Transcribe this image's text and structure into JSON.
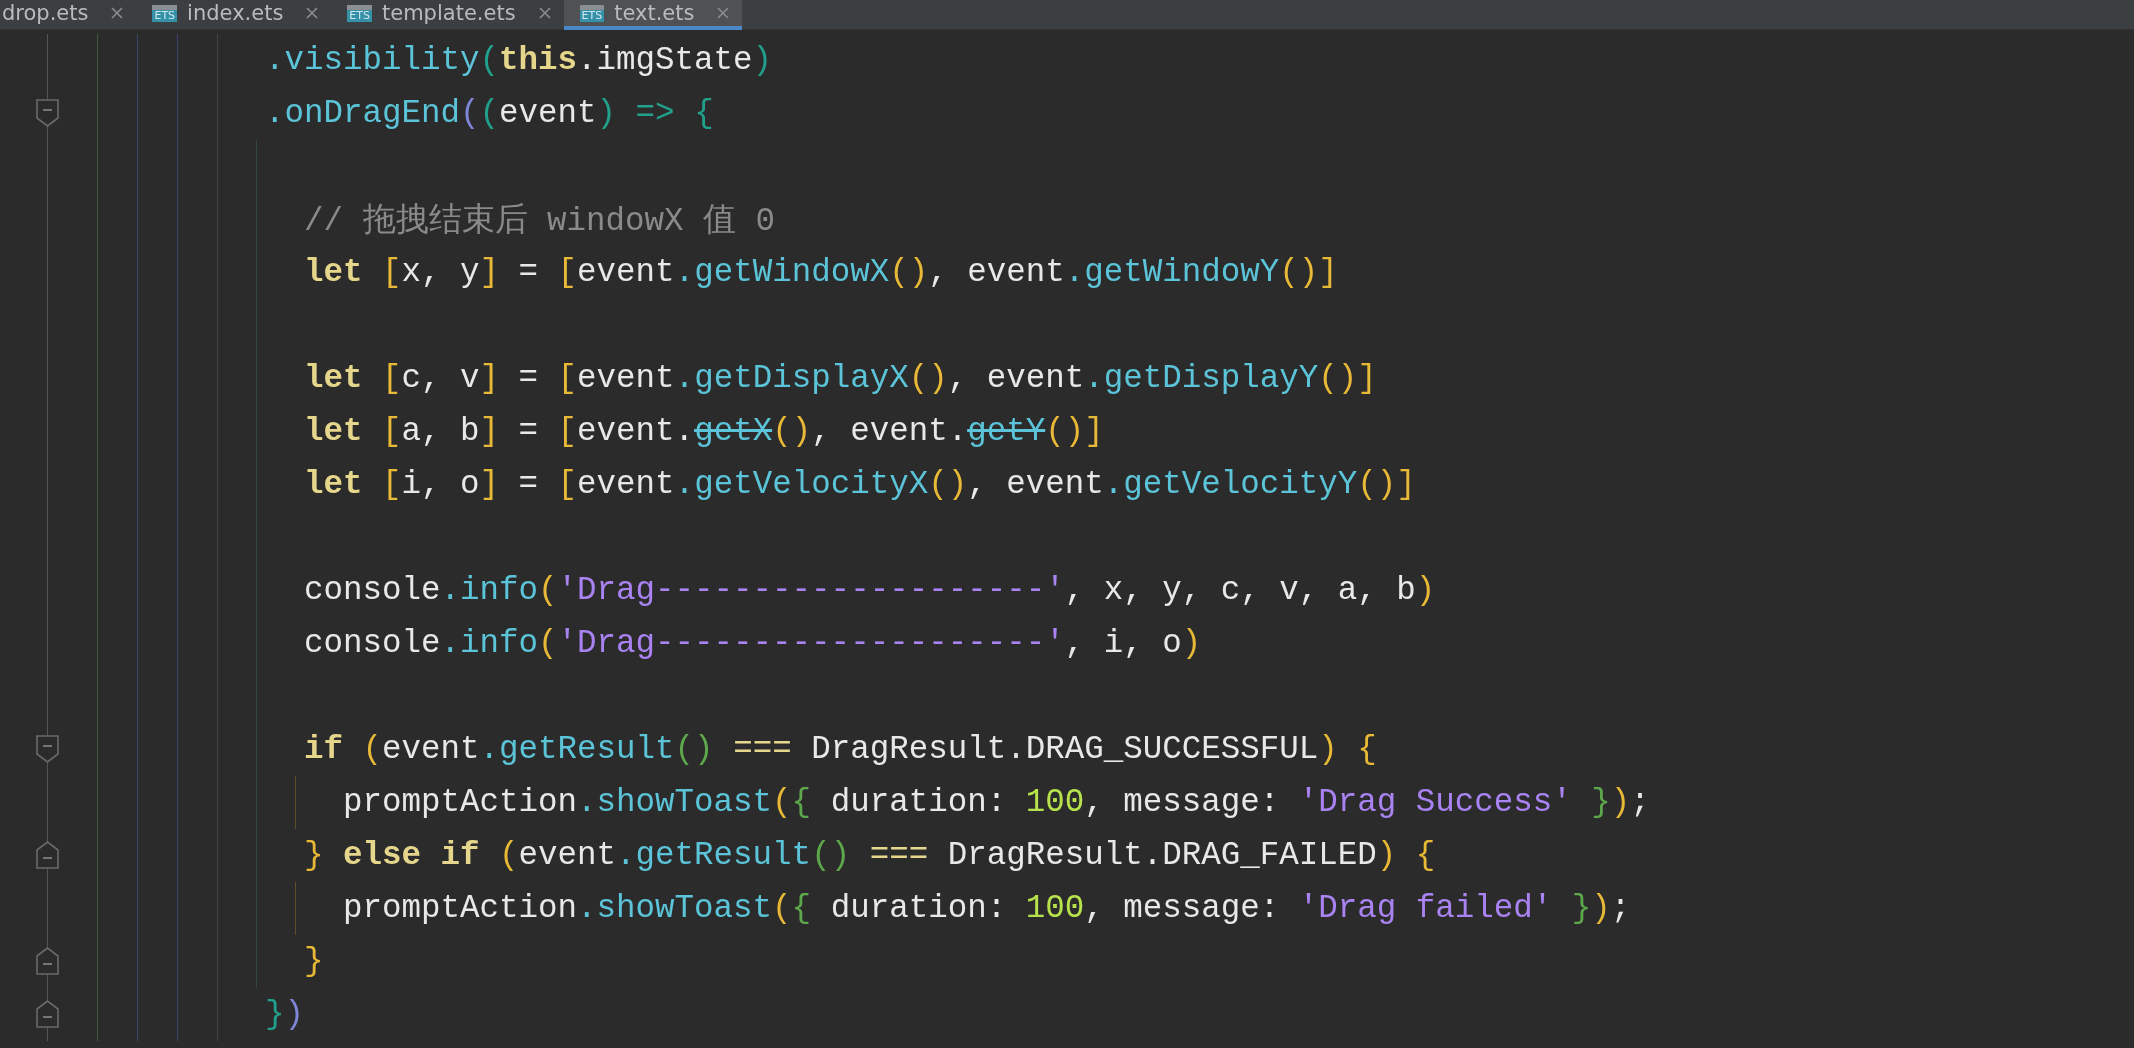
{
  "tabs": [
    {
      "label": "drop.ets",
      "selected": false
    },
    {
      "badge": "ETS",
      "label": "index.ets",
      "selected": false
    },
    {
      "badge": "ETS",
      "label": "template.ets",
      "selected": false
    },
    {
      "badge": "ETS",
      "label": "text.ets",
      "selected": true
    }
  ],
  "editor": {
    "lines": [
      {
        "kind": "code",
        "tokens": [
          {
            "kind": "method",
            "text": ".visibility"
          },
          {
            "kind": "teal",
            "text": "("
          },
          {
            "kind": "keyword",
            "text": "this"
          },
          {
            "kind": "plain",
            "text": ".imgState"
          },
          {
            "kind": "teal",
            "text": ")"
          }
        ]
      },
      {
        "kind": "fold-start",
        "tokens": [
          {
            "kind": "method",
            "text": ".onDragEnd"
          },
          {
            "kind": "violet",
            "text": "("
          },
          {
            "kind": "teal",
            "text": "("
          },
          {
            "kind": "plain",
            "text": "event"
          },
          {
            "kind": "teal",
            "text": ") => {"
          }
        ],
        "children": [
          {
            "kind": "blank"
          },
          {
            "kind": "code",
            "tokens": [
              {
                "kind": "comment",
                "text": "// 拖拽结束后 windowX 值 0"
              }
            ]
          },
          {
            "kind": "code",
            "tokens": [
              {
                "kind": "keyword",
                "text": "let "
              },
              {
                "kind": "gold",
                "text": "["
              },
              {
                "kind": "plain",
                "text": "x, y"
              },
              {
                "kind": "gold",
                "text": "]"
              },
              {
                "kind": "plain",
                "text": " = "
              },
              {
                "kind": "gold",
                "text": "["
              },
              {
                "kind": "plain",
                "text": "event"
              },
              {
                "kind": "method",
                "text": ".getWindowX"
              },
              {
                "kind": "gold",
                "text": "()"
              },
              {
                "kind": "plain",
                "text": ", event"
              },
              {
                "kind": "method",
                "text": ".getWindowY"
              },
              {
                "kind": "gold",
                "text": "()]"
              }
            ]
          },
          {
            "kind": "blank"
          },
          {
            "kind": "code",
            "tokens": [
              {
                "kind": "keyword",
                "text": "let "
              },
              {
                "kind": "gold",
                "text": "["
              },
              {
                "kind": "plain",
                "text": "c, v"
              },
              {
                "kind": "gold",
                "text": "]"
              },
              {
                "kind": "plain",
                "text": " = "
              },
              {
                "kind": "gold",
                "text": "["
              },
              {
                "kind": "plain",
                "text": "event"
              },
              {
                "kind": "method",
                "text": ".getDisplayX"
              },
              {
                "kind": "gold",
                "text": "()"
              },
              {
                "kind": "plain",
                "text": ", event"
              },
              {
                "kind": "method",
                "text": ".getDisplayY"
              },
              {
                "kind": "gold",
                "text": "()]"
              }
            ]
          },
          {
            "kind": "code",
            "tokens": [
              {
                "kind": "keyword",
                "text": "let "
              },
              {
                "kind": "gold",
                "text": "["
              },
              {
                "kind": "plain",
                "text": "a, b"
              },
              {
                "kind": "gold",
                "text": "]"
              },
              {
                "kind": "plain",
                "text": " = "
              },
              {
                "kind": "gold",
                "text": "["
              },
              {
                "kind": "plain",
                "text": "event."
              },
              {
                "kind": "deprecated",
                "text": "getX"
              },
              {
                "kind": "gold",
                "text": "()"
              },
              {
                "kind": "plain",
                "text": ", event."
              },
              {
                "kind": "deprecated",
                "text": "getY"
              },
              {
                "kind": "gold",
                "text": "()]"
              }
            ]
          },
          {
            "kind": "code",
            "tokens": [
              {
                "kind": "keyword",
                "text": "let "
              },
              {
                "kind": "gold",
                "text": "["
              },
              {
                "kind": "plain",
                "text": "i, o"
              },
              {
                "kind": "gold",
                "text": "]"
              },
              {
                "kind": "plain",
                "text": " = "
              },
              {
                "kind": "gold",
                "text": "["
              },
              {
                "kind": "plain",
                "text": "event"
              },
              {
                "kind": "method",
                "text": ".getVelocityX"
              },
              {
                "kind": "gold",
                "text": "()"
              },
              {
                "kind": "plain",
                "text": ", event"
              },
              {
                "kind": "method",
                "text": ".getVelocityY"
              },
              {
                "kind": "gold",
                "text": "()]"
              }
            ]
          },
          {
            "kind": "blank"
          },
          {
            "kind": "code",
            "tokens": [
              {
                "kind": "plain",
                "text": "console"
              },
              {
                "kind": "method",
                "text": ".info"
              },
              {
                "kind": "gold",
                "text": "("
              },
              {
                "kind": "string",
                "text": "'Drag--------------------'"
              },
              {
                "kind": "plain",
                "text": ", x, y, c, v, a, b"
              },
              {
                "kind": "gold",
                "text": ")"
              }
            ]
          },
          {
            "kind": "code",
            "tokens": [
              {
                "kind": "plain",
                "text": "console"
              },
              {
                "kind": "method",
                "text": ".info"
              },
              {
                "kind": "gold",
                "text": "("
              },
              {
                "kind": "string",
                "text": "'Drag--------------------'"
              },
              {
                "kind": "plain",
                "text": ", i, o"
              },
              {
                "kind": "gold",
                "text": ")"
              }
            ]
          },
          {
            "kind": "blank"
          },
          {
            "kind": "fold-start",
            "tokens": [
              {
                "kind": "keyword",
                "text": "if "
              },
              {
                "kind": "gold",
                "text": "("
              },
              {
                "kind": "plain",
                "text": "event"
              },
              {
                "kind": "method",
                "text": ".getResult"
              },
              {
                "kind": "green",
                "text": "()"
              },
              {
                "kind": "operator",
                "text": " === "
              },
              {
                "kind": "plain",
                "text": "DragResult.DRAG_SUCCESSFUL"
              },
              {
                "kind": "gold",
                "text": ") {"
              }
            ],
            "children": [
              {
                "kind": "code",
                "tokens": [
                  {
                    "kind": "plain",
                    "text": "promptAction"
                  },
                  {
                    "kind": "method",
                    "text": ".showToast"
                  },
                  {
                    "kind": "gold",
                    "text": "("
                  },
                  {
                    "kind": "green",
                    "text": "{"
                  },
                  {
                    "kind": "plain",
                    "text": " duration: "
                  },
                  {
                    "kind": "number",
                    "text": "100"
                  },
                  {
                    "kind": "plain",
                    "text": ", message: "
                  },
                  {
                    "kind": "string",
                    "text": "'Drag Success'"
                  },
                  {
                    "kind": "green",
                    "text": " }"
                  },
                  {
                    "kind": "gold",
                    "text": ")"
                  },
                  {
                    "kind": "plain",
                    "text": ";"
                  }
                ]
              }
            ]
          },
          {
            "kind": "fold-end",
            "tokens": [
              {
                "kind": "gold",
                "text": "}"
              },
              {
                "kind": "keyword",
                "text": " else if "
              },
              {
                "kind": "gold",
                "text": "("
              },
              {
                "kind": "plain",
                "text": "event"
              },
              {
                "kind": "method",
                "text": ".getResult"
              },
              {
                "kind": "green",
                "text": "()"
              },
              {
                "kind": "operator",
                "text": " === "
              },
              {
                "kind": "plain",
                "text": "DragResult.DRAG_FAILED"
              },
              {
                "kind": "gold",
                "text": ") {"
              }
            ],
            "children": [
              {
                "kind": "code",
                "tokens": [
                  {
                    "kind": "plain",
                    "text": "promptAction"
                  },
                  {
                    "kind": "method",
                    "text": ".showToast"
                  },
                  {
                    "kind": "gold",
                    "text": "("
                  },
                  {
                    "kind": "green",
                    "text": "{"
                  },
                  {
                    "kind": "plain",
                    "text": " duration: "
                  },
                  {
                    "kind": "number",
                    "text": "100"
                  },
                  {
                    "kind": "plain",
                    "text": ", message: "
                  },
                  {
                    "kind": "string",
                    "text": "'Drag failed'"
                  },
                  {
                    "kind": "green",
                    "text": " }"
                  },
                  {
                    "kind": "gold",
                    "text": ")"
                  },
                  {
                    "kind": "plain",
                    "text": ";"
                  }
                ]
              }
            ]
          },
          {
            "kind": "fold-end",
            "tokens": [
              {
                "kind": "gold",
                "text": "}"
              }
            ]
          }
        ]
      },
      {
        "kind": "fold-end",
        "tokens": [
          {
            "kind": "teal",
            "text": "}"
          },
          {
            "kind": "violet",
            "text": ")"
          }
        ]
      }
    ]
  }
}
